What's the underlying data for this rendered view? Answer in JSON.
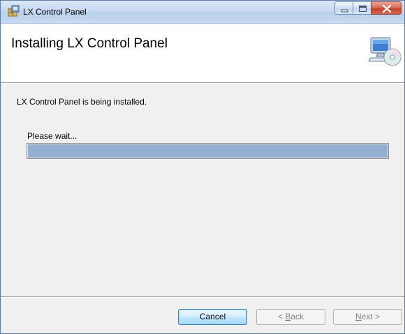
{
  "window": {
    "title": "LX Control Panel"
  },
  "banner": {
    "title": "Installing LX Control Panel"
  },
  "body": {
    "status": "LX Control Panel is being installed.",
    "wait_label": "Please wait...",
    "progress_fraction": 1.0
  },
  "buttons": {
    "cancel": "Cancel",
    "back_arrow": "< ",
    "back_key": "B",
    "back_rest": "ack",
    "next_key": "N",
    "next_rest": "ext",
    "next_arrow": " >"
  },
  "icons": {
    "title": "installer-package-icon",
    "banner": "computer-cd-icon"
  },
  "colors": {
    "progress_fill": "#94afd1",
    "close_button": "#c4402a"
  }
}
